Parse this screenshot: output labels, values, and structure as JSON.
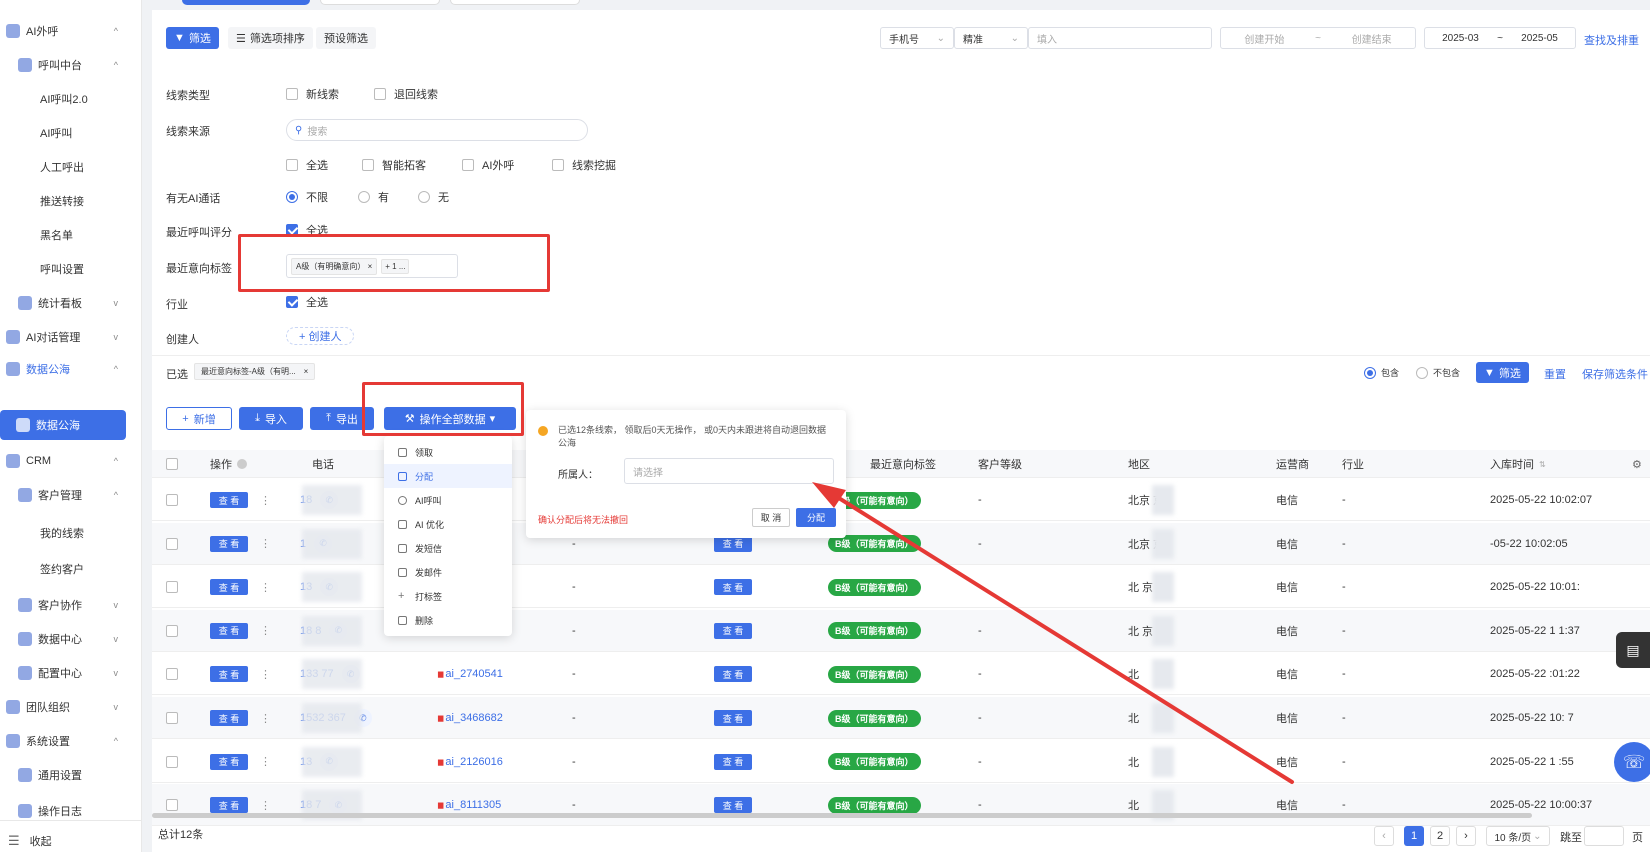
{
  "sidebar": {
    "items": [
      {
        "label": "AI外呼",
        "chev": "^"
      },
      {
        "label": "呼叫中台",
        "chev": "^"
      },
      {
        "label": "AI呼叫2.0"
      },
      {
        "label": "AI呼叫"
      },
      {
        "label": "人工呼出"
      },
      {
        "label": "推送转接"
      },
      {
        "label": "黑名单"
      },
      {
        "label": "呼叫设置"
      },
      {
        "label": "统计看板",
        "chev": "v"
      },
      {
        "label": "AI对话管理",
        "chev": "v"
      },
      {
        "label": "数据公海",
        "chev": "^"
      },
      {
        "label": "数据公海"
      },
      {
        "label": "CRM",
        "chev": "^"
      },
      {
        "label": "客户管理",
        "chev": "^"
      },
      {
        "label": "我的线索"
      },
      {
        "label": "签约客户"
      },
      {
        "label": "客户协作",
        "chev": "v"
      },
      {
        "label": "数据中心",
        "chev": "v"
      },
      {
        "label": "配置中心",
        "chev": "v"
      },
      {
        "label": "团队组织",
        "chev": "v"
      },
      {
        "label": "系统设置",
        "chev": "^"
      },
      {
        "label": "通用设置"
      },
      {
        "label": "操作日志"
      }
    ],
    "collapse": "收起"
  },
  "toolbar": {
    "filter": "筛选",
    "filter_sort": "筛选项排序",
    "preset": "预设筛选",
    "phone_select": "手机号",
    "match_select": "精准",
    "input_placeholder": "填入",
    "create_start": "创建开始",
    "tilde": "~",
    "create_end": "创建结束",
    "date_start": "2025-03",
    "date_end": "2025-05",
    "search_reset": "查找及排重"
  },
  "filters": {
    "lead_type": {
      "label": "线索类型",
      "options": [
        "新线索",
        "退回线索"
      ]
    },
    "lead_source": {
      "label": "线索来源",
      "search_placeholder": "搜索",
      "options": [
        "全选",
        "智能拓客",
        "AI外呼",
        "线索挖掘"
      ]
    },
    "ai_call": {
      "label": "有无AI通话",
      "options": [
        "不限",
        "有",
        "无"
      ]
    },
    "call_score": {
      "label": "最近呼叫评分",
      "option": "全选"
    },
    "intent_tag": {
      "label": "最近意向标签",
      "chip": "A级（有明确意向）",
      "more": "+ 1 ..."
    },
    "industry": {
      "label": "行业",
      "option": "全选"
    },
    "creator": {
      "label": "创建人",
      "button": "+ 创建人"
    }
  },
  "selected": {
    "label": "已选",
    "chip": "最近意向标签-A级（有明...",
    "include": "包含",
    "exclude": "不包含",
    "filter_btn": "筛选",
    "reset": "重置",
    "save": "保存筛选条件"
  },
  "actions": {
    "add": "新增",
    "import": "导入",
    "export": "导出",
    "operate_all": "操作全部数据"
  },
  "dropdown": [
    "领取",
    "分配",
    "AI呼叫",
    "AI 优化",
    "发短信",
    "发邮件",
    "打标签",
    "删除"
  ],
  "popover": {
    "message": "已选12条线索， 领取后0天无操作， 或0天内未跟进将自动退回数据公海",
    "owner_label": "所属人：",
    "owner_placeholder": "请选择",
    "warning": "确认分配后将无法撤回",
    "cancel": "取 消",
    "confirm": "分配"
  },
  "table": {
    "headers": {
      "op": "操作",
      "phone": "电话",
      "intent": "最近意向标签",
      "level": "客户等级",
      "region": "地区",
      "carrier": "运营商",
      "industry": "行业",
      "time": "入库时间"
    },
    "view": "查 看",
    "rows": [
      {
        "phone": "18",
        "name": "",
        "intent": "B级（可能有意向）",
        "level": "-",
        "region": "北京  京",
        "carrier": "电信",
        "industry": "-",
        "time": "2025-05-22 10:02:07",
        "dash": "-"
      },
      {
        "phone": "1",
        "name": "",
        "intent": "B级（可能有意向）",
        "level": "-",
        "region": "北京  京",
        "carrier": "电信",
        "industry": "-",
        "time": "  -05-22 10:02:05",
        "dash": "-"
      },
      {
        "phone": "13",
        "name": "",
        "intent": "B级（可能有意向）",
        "level": "-",
        "region": "北   京",
        "carrier": "电信",
        "industry": "-",
        "time": "2025-05-22 10:01:",
        "dash": "-"
      },
      {
        "phone": "18   8",
        "name": "",
        "intent": "B级（可能有意向）",
        "level": "-",
        "region": "北   京",
        "carrier": "电信",
        "industry": "-",
        "time": "2025-05-22 1  1:37",
        "dash": "-"
      },
      {
        "phone": "133    77",
        "name": "ai_2740541",
        "intent": "B级（可能有意向）",
        "level": "-",
        "region": "北",
        "carrier": "电信",
        "industry": "-",
        "time": "2025-05-22  :01:22",
        "dash": "-"
      },
      {
        "phone": "1532    367",
        "name": "ai_3468682",
        "intent": "B级（可能有意向）",
        "level": "-",
        "region": "北",
        "carrier": "电信",
        "industry": "-",
        "time": "2025-05-22 10:  7",
        "dash": "-"
      },
      {
        "phone": "13",
        "name": "ai_2126016",
        "intent": "B级（可能有意向）",
        "level": "-",
        "region": "北",
        "carrier": "电信",
        "industry": "-",
        "time": "2025-05-22 1  :55",
        "dash": "-"
      },
      {
        "phone": "18    7",
        "name": "ai_8111305",
        "intent": "B级（可能有意向）",
        "level": "-",
        "region": "北",
        "carrier": "电信",
        "industry": "-",
        "time": "2025-05-22 10:00:37",
        "dash": "-"
      }
    ]
  },
  "footer": {
    "total": "总计12条",
    "pages": [
      "1",
      "2"
    ],
    "page_size": "10 条/页",
    "jump": "跳至",
    "page_unit": "页"
  }
}
